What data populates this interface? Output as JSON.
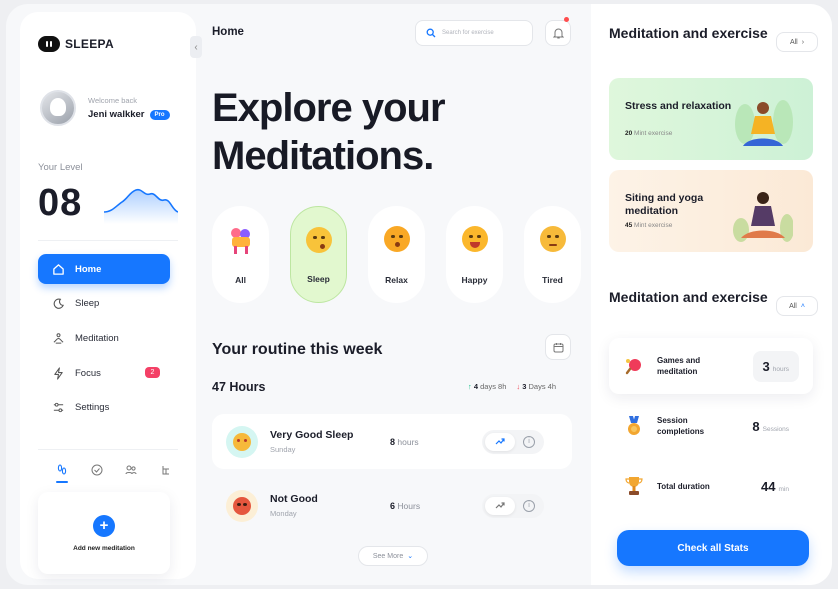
{
  "brand": {
    "name": "SLEEPA"
  },
  "profile": {
    "welcome": "Welcome back",
    "name": "Jeni walkker",
    "badge": "Pro"
  },
  "level": {
    "label": "Your Level",
    "value": "08"
  },
  "nav": [
    {
      "label": "Home",
      "icon": "home-icon",
      "active": true
    },
    {
      "label": "Sleep",
      "icon": "moon-icon"
    },
    {
      "label": "Meditation",
      "icon": "meditation-icon"
    },
    {
      "label": "Focus",
      "icon": "lightning-icon",
      "badge": "2"
    },
    {
      "label": "Settings",
      "icon": "sliders-icon"
    }
  ],
  "bottom_tabs": [
    "footprints-icon",
    "check-circle-icon",
    "users-icon",
    "tree-icon"
  ],
  "add_meditation": {
    "label": "Add new meditation"
  },
  "header": {
    "breadcrumb": "Home",
    "search_placeholder": "Search for exercise"
  },
  "hero": {
    "line1": "Explore your",
    "line2": "Meditations."
  },
  "moods": [
    {
      "label": "All",
      "key": "all"
    },
    {
      "label": "Sleep",
      "key": "sleep",
      "active": true
    },
    {
      "label": "Relax",
      "key": "relax"
    },
    {
      "label": "Happy",
      "key": "happy"
    },
    {
      "label": "Tired",
      "key": "tired"
    }
  ],
  "routine": {
    "title": "Your routine this week",
    "total": "47 Hours",
    "up": {
      "value": "4",
      "label": "days 8h"
    },
    "down": {
      "value": "3",
      "label": "Days 4h"
    },
    "rows": [
      {
        "title": "Very Good Sleep",
        "day": "Sunday",
        "hours": "8",
        "unit": "hours"
      },
      {
        "title": "Not Good",
        "day": "Monday",
        "hours": "6",
        "unit": "Hours"
      }
    ],
    "see_more": "See More"
  },
  "right": {
    "section1": {
      "title": "Meditation and exercise",
      "filter": "All"
    },
    "cards": [
      {
        "title": "Stress and relaxation",
        "count": "20",
        "count_label": "Mint exercise"
      },
      {
        "title": "Siting and yoga meditation",
        "count": "45",
        "count_label": "Mint exercise"
      }
    ],
    "section2": {
      "title": "Meditation and exercise",
      "filter": "All"
    },
    "stats": [
      {
        "label": "Games and meditation",
        "value": "3",
        "unit": "hours",
        "icon": "ping-pong-icon"
      },
      {
        "label": "Session completions",
        "value": "8",
        "unit": "Sessions",
        "icon": "medal-icon"
      },
      {
        "label": "Total duration",
        "value": "44",
        "unit": "min",
        "icon": "trophy-icon"
      }
    ],
    "cta": "Check all Stats"
  },
  "colors": {
    "accent": "#1677ff",
    "mood_active": "#e2f8cf",
    "badge": "#f44066",
    "up": "#1ec28b",
    "down": "#f04455"
  }
}
